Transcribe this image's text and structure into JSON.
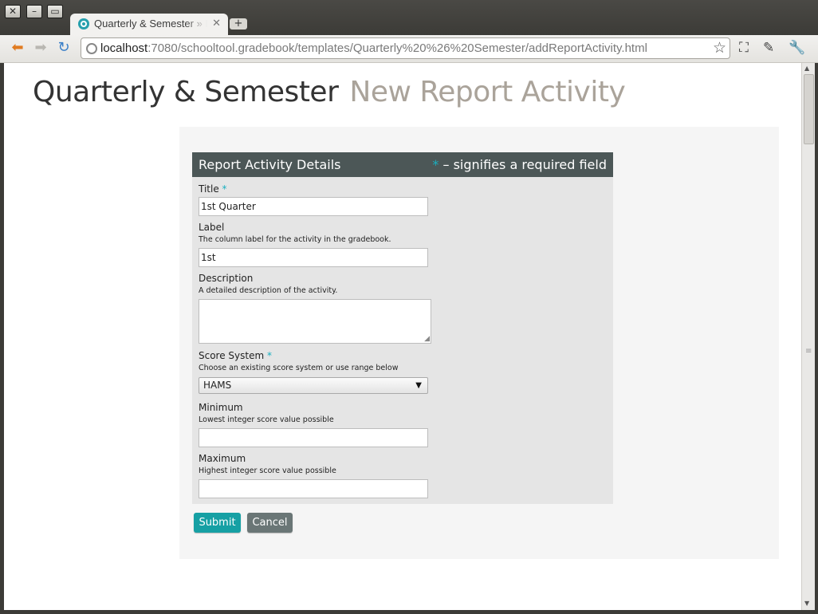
{
  "browser": {
    "tab_title": "Quarterly & Semester » New Report Activity",
    "new_tab_symbol": "+",
    "url_host": "localhost",
    "url_rest": ":7080/schooltool.gradebook/templates/Quarterly%20%26%20Semester/addReportActivity.html"
  },
  "page": {
    "title": "Quarterly & Semester",
    "subtitle": "New Report Activity"
  },
  "form": {
    "legend": "Report Activity Details",
    "required_star": "*",
    "required_note": " – signifies a required field",
    "title_label": "Title",
    "title_value": "1st Quarter",
    "label_label": "Label",
    "label_hint": "The column label for the activity in the gradebook.",
    "label_value": "1st",
    "description_label": "Description",
    "description_hint": "A detailed description of the activity.",
    "description_value": "",
    "score_system_label": "Score System",
    "score_system_hint": "Choose an existing score system or use range below",
    "score_system_value": "HAMS",
    "minimum_label": "Minimum",
    "minimum_hint": "Lowest integer score value possible",
    "minimum_value": "",
    "maximum_label": "Maximum",
    "maximum_hint": "Highest integer score value possible",
    "maximum_value": "",
    "submit_label": "Submit",
    "cancel_label": "Cancel"
  },
  "icons": [
    "close-icon",
    "minimize-icon",
    "maximize-icon",
    "favicon-icon",
    "tab-close-icon",
    "back-arrow-icon",
    "forward-arrow-icon",
    "reload-icon",
    "page-info-icon",
    "bookmark-star-icon",
    "page-actions-icon",
    "pin-icon",
    "wrench-icon",
    "dropdown-arrow-icon"
  ],
  "colors": {
    "accent": "#16a0a4",
    "legend_bg": "#4c5757",
    "required_star": "#1ab0c0",
    "cancel_bg": "#6a7676"
  }
}
